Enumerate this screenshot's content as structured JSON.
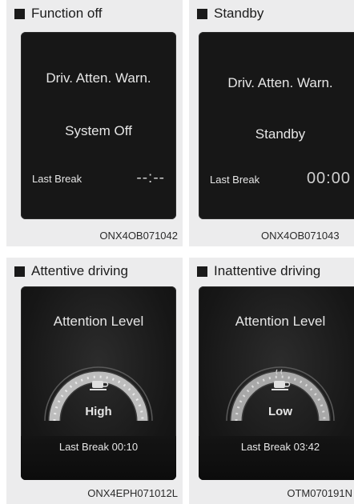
{
  "panels": [
    {
      "header": "Function off",
      "code": "ONX4OB071042",
      "line1": "Driv. Atten. Warn.",
      "line2": "System Off",
      "last_break_label": "Last Break",
      "last_break_value": "--:--"
    },
    {
      "header": "Standby",
      "code": "ONX4OB071043",
      "line1": "Driv. Atten. Warn.",
      "line2": "Standby",
      "last_break_label": "Last Break",
      "last_break_value": "00:00"
    },
    {
      "header": "Attentive driving",
      "code": "ONX4EPH071012L",
      "title": "Attention Level",
      "level": "High",
      "footer": "Last Break 00:10"
    },
    {
      "header": "Inattentive driving",
      "code": "OTM070191N",
      "title": "Attention Level",
      "level": "Low",
      "footer": "Last Break 03:42"
    }
  ],
  "icons": {
    "header_marker": "square-bullet-icon",
    "gauge_icon": "coffee-cup-icon"
  }
}
